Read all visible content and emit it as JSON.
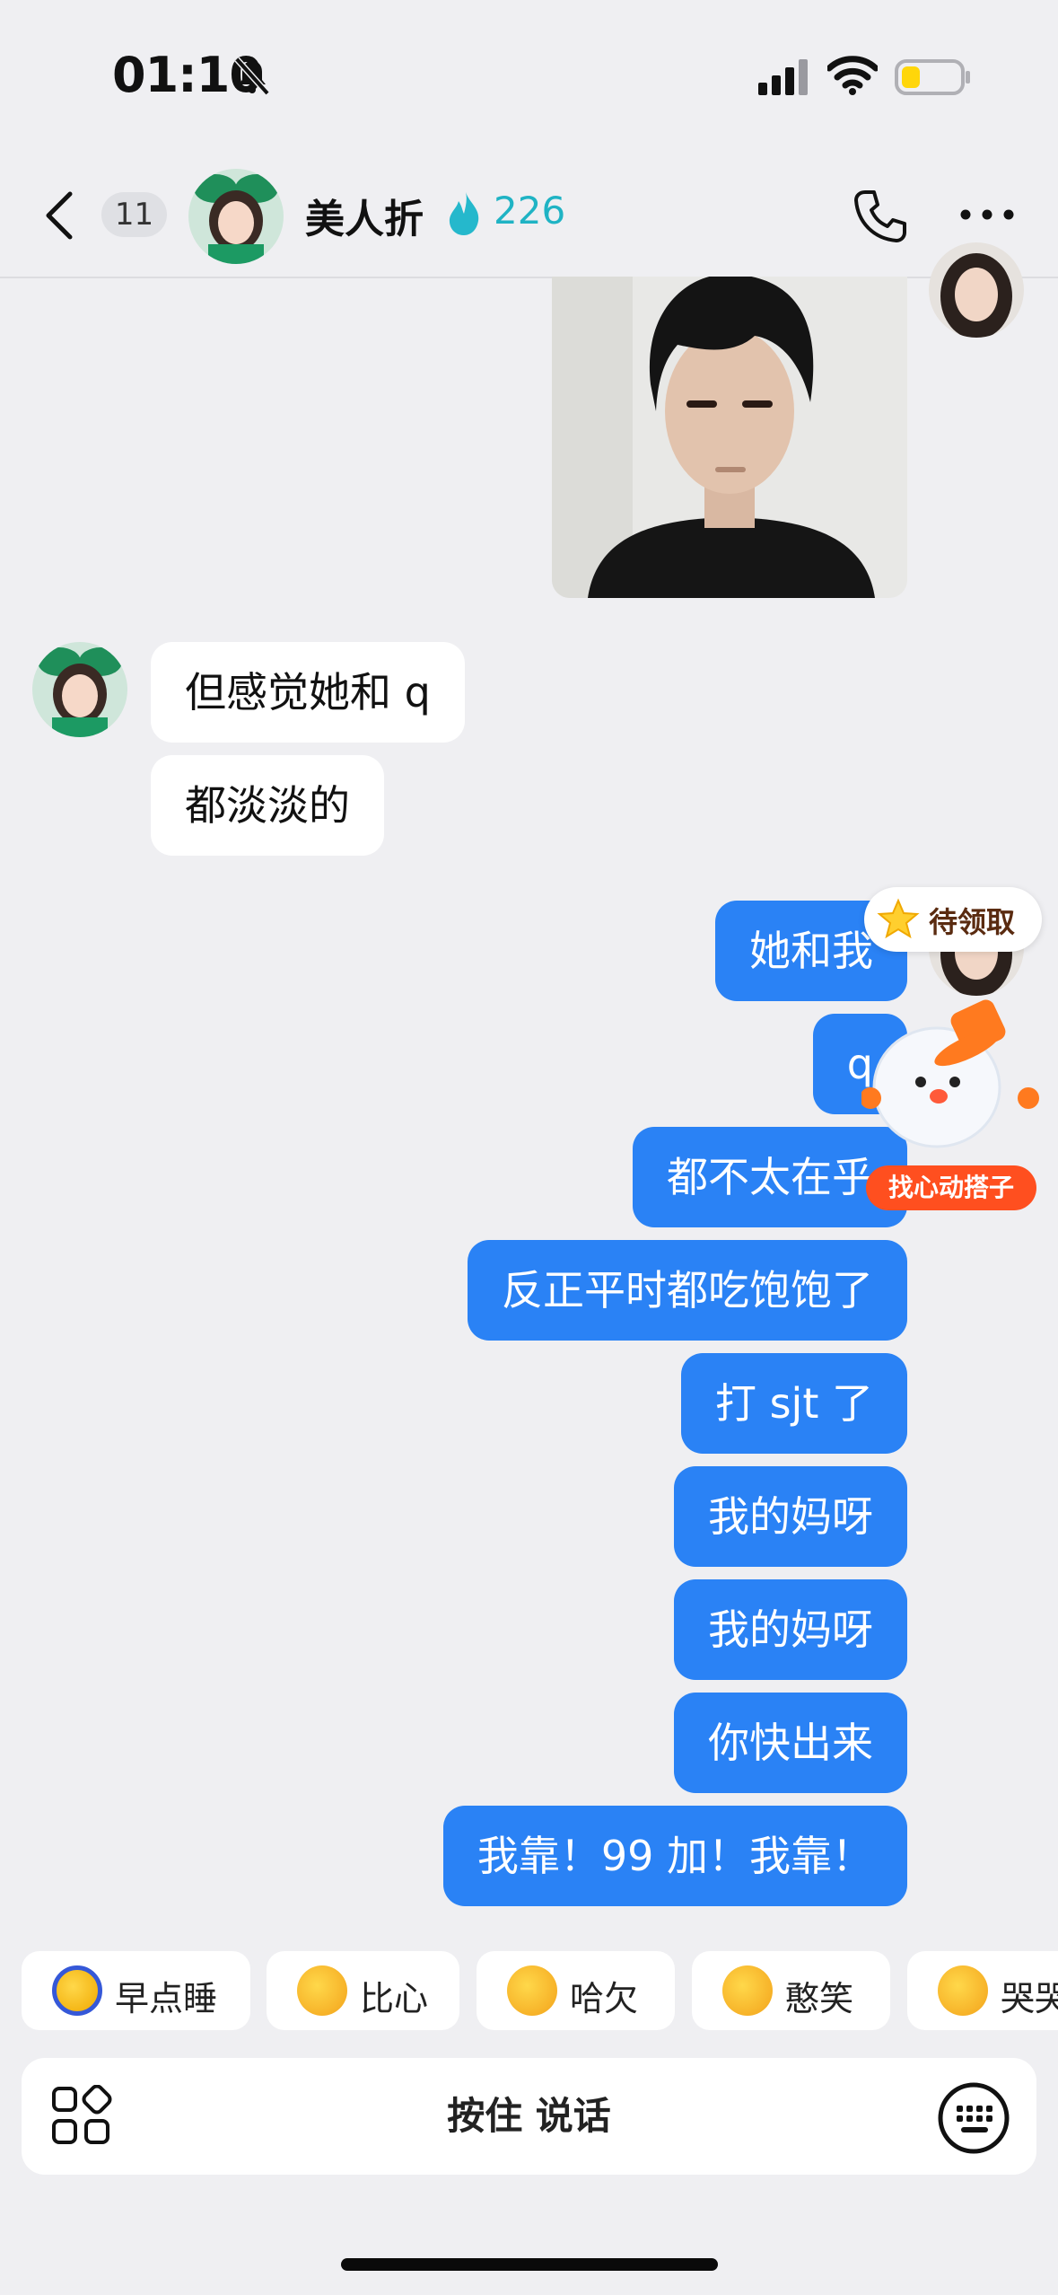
{
  "status": {
    "time": "01:10"
  },
  "header": {
    "unread_count": "11",
    "contact_name": "美人折",
    "streak_score": "226"
  },
  "incoming": [
    "但感觉她和 q",
    "都淡淡的"
  ],
  "outgoing": [
    "她和我",
    "q",
    "都不太在乎",
    "反正平时都吃饱饱了",
    "打 sjt 了",
    "我的妈呀",
    "我的妈呀",
    "你快出来",
    "我靠！99 加！我靠！"
  ],
  "widget": {
    "pending_label": "待领取",
    "match_label": "找心动搭子"
  },
  "quick_replies": [
    {
      "label": "早点睡",
      "icon": "sleep-emoji-icon"
    },
    {
      "label": "比心",
      "icon": "heart-hands-emoji-icon"
    },
    {
      "label": "哈欠",
      "icon": "yawn-emoji-icon"
    },
    {
      "label": "憨笑",
      "icon": "grin-emoji-icon"
    },
    {
      "label": "哭哭",
      "icon": "cry-emoji-icon"
    }
  ],
  "input": {
    "hold_to_talk": "按住 说话"
  },
  "colors": {
    "outgoing_bubble": "#2a82f5",
    "incoming_bubble": "#ffffff",
    "background": "#efeff2",
    "accent_orange": "#ff4f1f",
    "streak": "#1fb3c4"
  }
}
